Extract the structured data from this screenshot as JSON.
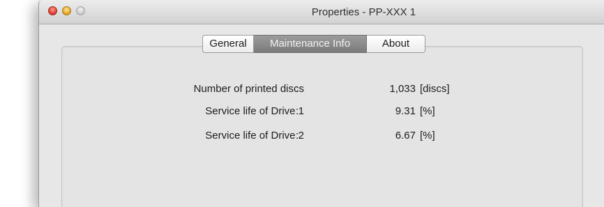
{
  "window": {
    "title": "Properties - PP-XXX 1"
  },
  "tabs": [
    {
      "label": "General",
      "active": false
    },
    {
      "label": "Maintenance Info",
      "active": true
    },
    {
      "label": "About",
      "active": false
    }
  ],
  "maintenance": {
    "rows": [
      {
        "label": "Number of printed discs",
        "separator": ":",
        "value": "1,033",
        "unit": "[discs]"
      },
      {
        "label": "Service life of Drive 1",
        "separator": ":",
        "value": "9.31",
        "unit": "[%]"
      },
      {
        "label": "Service life of Drive 2",
        "separator": ":",
        "value": "6.67",
        "unit": "[%]"
      }
    ]
  },
  "colors": {
    "window_bg": "#e7e7e7",
    "tab_active": "#8a8a8a",
    "close_button": "#d9362a",
    "minimize_button": "#e0a21c"
  }
}
